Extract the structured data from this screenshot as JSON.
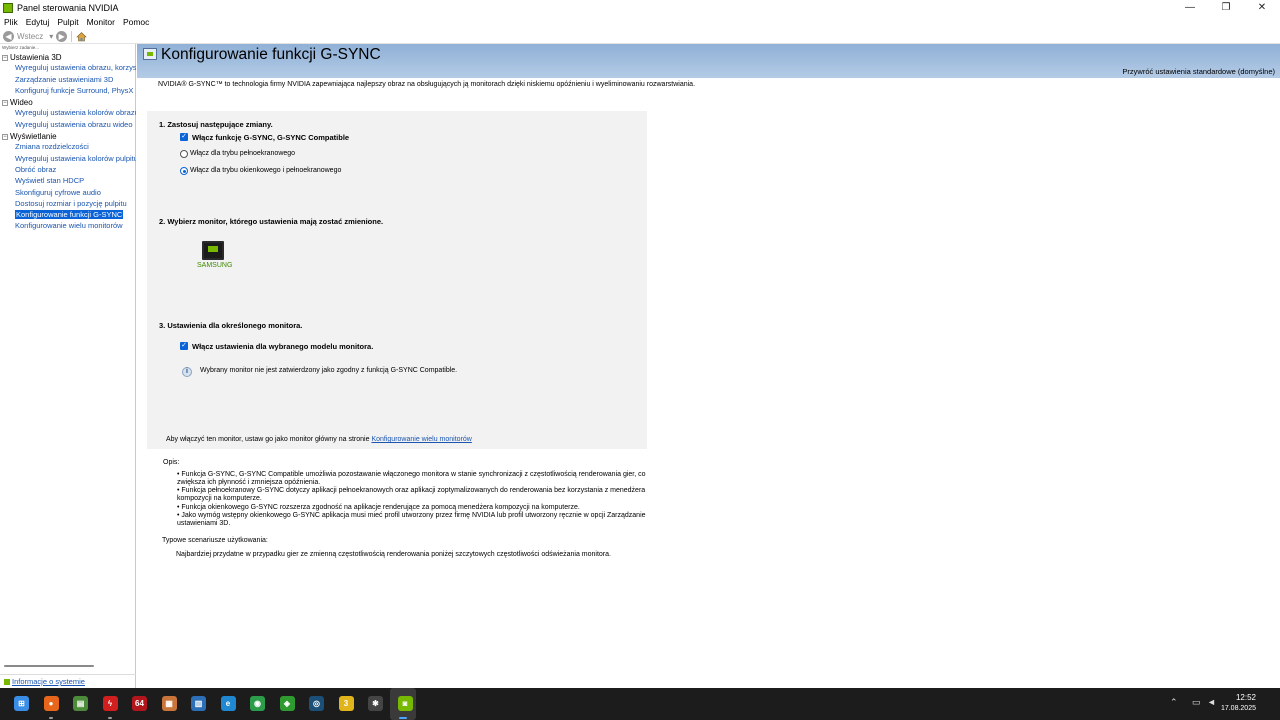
{
  "window": {
    "title": "Panel sterowania NVIDIA",
    "minimize": "—",
    "maximize": "❐",
    "close": "✕"
  },
  "menu": [
    "Plik",
    "Edytuj",
    "Pulpit",
    "Monitor",
    "Pomoc"
  ],
  "toolbar": {
    "back_label": "Wstecz",
    "back_glyph": "◀",
    "forward_glyph": "▶",
    "dropdown_glyph": "▾"
  },
  "sidebar": {
    "caption": "Wybierz zadanie...",
    "categories": [
      {
        "label": "Ustawienia 3D",
        "items": [
          "Wyreguluj ustawienia obrazu, korzysta",
          "Zarządzanie ustawieniami 3D",
          "Konfiguruj funkcje Surround, PhysX"
        ]
      },
      {
        "label": "Wideo",
        "items": [
          "Wyreguluj ustawienia kolorów obrazu",
          "Wyreguluj ustawienia obrazu wideo"
        ]
      },
      {
        "label": "Wyświetlanie",
        "items": [
          "Zmiana rozdzielczości",
          "Wyreguluj ustawienia kolorów pulpitu",
          "Obróć obraz",
          "Wyświetl stan HDCP",
          "Skonfiguruj cyfrowe audio",
          "Dostosuj rozmiar i pozycję pulpitu",
          "Konfigurowanie funkcji G-SYNC",
          "Konfigurowanie wielu monitorów"
        ]
      }
    ],
    "selected_item": "Konfigurowanie funkcji G-SYNC",
    "system_info": "Informacje o systemie"
  },
  "page": {
    "title": "Konfigurowanie funkcji G-SYNC",
    "restore_defaults": "Przywróć ustawienia standardowe (domyślne)",
    "intro": "NVIDIA® G-SYNC™ to technologia firmy NVIDIA zapewniająca najlepszy obraz na obsługujących ją monitorach dzięki niskiemu opóźnieniu i wyeliminowaniu rozwarstwiania.",
    "section1": {
      "title": "1. Zastosuj następujące zmiany.",
      "enable_gsync": "Włącz funkcję G-SYNC, G-SYNC Compatible",
      "enable_gsync_checked": true,
      "radio_fullscreen": "Włącz dla trybu pełnoekranowego",
      "radio_windowed": "Włącz dla trybu okienkowego i pełnoekranowego",
      "selected_mode": "windowed"
    },
    "section2": {
      "title": "2. Wybierz monitor, którego ustawienia mają zostać zmienione.",
      "monitor_name": "SAMSUNG"
    },
    "section3": {
      "title": "3. Ustawienia dla określonego monitora.",
      "enable_model": "Włącz ustawienia dla wybranego modelu monitora.",
      "enable_model_checked": true,
      "info": "Wybrany monitor nie jest zatwierdzony jako zgodny z funkcją G-SYNC Compatible."
    },
    "footer_note": "Aby włączyć ten monitor, ustaw go jako monitor główny na stronie",
    "footer_link": "Konfigurowanie wielu monitorów",
    "description_label": "Opis:",
    "description_bullets": [
      "• Funkcja G-SYNC, G-SYNC Compatible umożliwia pozostawanie włączonego monitora w stanie synchronizacji z częstotliwością renderowania gier, co zwiększa ich płynność i zmniejsza opóźnienia.",
      "• Funkcja pełnoekranowy G-SYNC dotyczy aplikacji pełnoekranowych oraz aplikacji zoptymalizowanych do renderowania bez korzystania z menedżera kompozycji na komputerze.",
      "• Funkcja okienkowego G-SYNC rozszerza zgodność na aplikacje renderujące za pomocą menedżera kompozycji na komputerze.",
      "• Jako wymóg wstępny okienkowego G-SYNC aplikacja musi mieć profil utworzony przez firmę NVIDIA lub profil utworzony ręcznie w opcji Zarządzanie ustawieniami 3D."
    ],
    "usage_label": "Typowe scenariusze użytkowania:",
    "usage_text": "Najbardziej przydatne w przypadku gier ze zmienną częstotliwością renderowania poniżej szczytowych częstotliwości odświeżania monitora."
  },
  "taskbar": {
    "icons": [
      {
        "name": "windows-start-icon",
        "color": "#3a8ee6",
        "glyph": "⊞"
      },
      {
        "name": "firefox-icon",
        "color": "#e8661b",
        "glyph": "●"
      },
      {
        "name": "file-manager-icon",
        "color": "#4c8b3a",
        "glyph": "▤"
      },
      {
        "name": "lightning-app-icon",
        "color": "#d11f1f",
        "glyph": "ϟ"
      },
      {
        "name": "aida64-icon",
        "color": "#b0161c",
        "glyph": "64"
      },
      {
        "name": "cpuz-icon",
        "color": "#c8743a",
        "glyph": "▦"
      },
      {
        "name": "hwinfo-icon",
        "color": "#2d6fb7",
        "glyph": "▥"
      },
      {
        "name": "browser-e-icon",
        "color": "#1f88d0",
        "glyph": "e"
      },
      {
        "name": "green-app-icon",
        "color": "#2c9c4a",
        "glyph": "◉"
      },
      {
        "name": "excel-like-icon",
        "color": "#2f9a2f",
        "glyph": "◈"
      },
      {
        "name": "steam-icon",
        "color": "#1b4f78",
        "glyph": "◎"
      },
      {
        "name": "yellow-app-icon",
        "color": "#e0b41a",
        "glyph": "3"
      },
      {
        "name": "bug-app-icon",
        "color": "#444444",
        "glyph": "✱"
      },
      {
        "name": "nvidia-icon",
        "color": "#76b900",
        "glyph": "◙"
      }
    ],
    "tray_up": "⌃",
    "tray_display": "▭",
    "tray_volume": "◄",
    "time": "12:52",
    "date": "17.08.2025"
  }
}
